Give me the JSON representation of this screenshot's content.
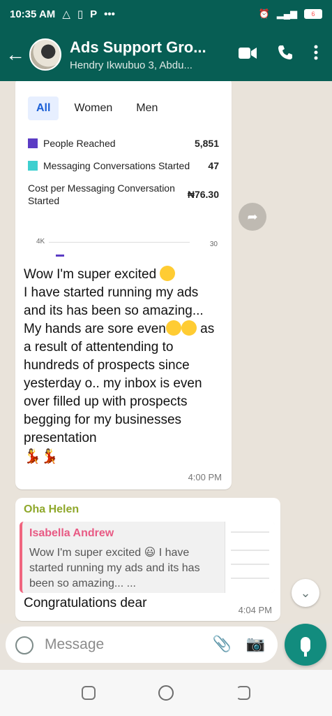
{
  "status_bar": {
    "time": "10:35 AM",
    "battery": "6"
  },
  "app_bar": {
    "title": "Ads Support Gro...",
    "subtitle": "Hendry Ikwubuo 3, Abdu..."
  },
  "card": {
    "tabs": [
      "All",
      "Women",
      "Men"
    ],
    "active_tab": "All",
    "metrics": [
      {
        "label": "People Reached",
        "value": "5,851",
        "color": "#5b3cc4"
      },
      {
        "label": "Messaging Conversations Started",
        "value": "47",
        "color": "#3ecfcf"
      },
      {
        "label": "Cost per Messaging Conversation Started",
        "value": "₦76.30",
        "color": ""
      }
    ],
    "chart_left_tick": "4K",
    "chart_right_tick": "30"
  },
  "message1": {
    "line1": "Wow I'm super excited",
    "body": "I have started running my ads and its has been so amazing... My hands are sore even",
    "body2": "as a result of attentending to hundreds  of prospects since yesterday o.. my inbox is even over filled up with prospects begging for my businesses presentation",
    "time": "4:00 PM"
  },
  "message2": {
    "sender": "Oha Helen",
    "quote_author": "Isabella Andrew",
    "quote_text": "Wow I'm super excited 😃 I have started running my ads and its has been so amazing... ...",
    "reply": "Congratulations dear",
    "time": "4:04 PM"
  },
  "input": {
    "placeholder": "Message"
  },
  "colors": {
    "header": "#075e54",
    "accent": "#128c7e"
  }
}
